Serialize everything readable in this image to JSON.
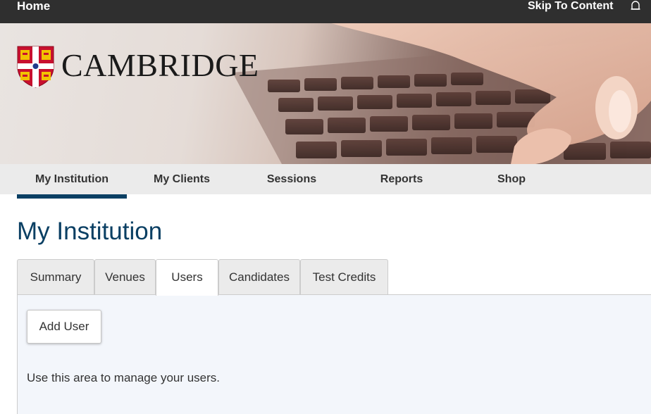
{
  "topbar": {
    "home_label": "Home",
    "skip_label": "Skip To Content",
    "bell_icon": "bell-icon"
  },
  "header": {
    "logo_icon": "cambridge-shield-logo",
    "logo_text": "CAMBRIDGE"
  },
  "main_nav": {
    "items": [
      {
        "label": "My Institution",
        "active": true
      },
      {
        "label": "My Clients"
      },
      {
        "label": "Sessions"
      },
      {
        "label": "Reports"
      },
      {
        "label": "Shop"
      }
    ]
  },
  "page": {
    "title": "My Institution"
  },
  "tabs": [
    {
      "label": "Summary"
    },
    {
      "label": "Venues"
    },
    {
      "label": "Users",
      "active": true
    },
    {
      "label": "Candidates"
    },
    {
      "label": "Test Credits"
    }
  ],
  "panel": {
    "add_user_label": "Add User",
    "description": "Use this area to manage your users."
  },
  "colors": {
    "topbar": "#2f2f2f",
    "nav_background": "#ebebeb",
    "accent": "#0a3f63",
    "panel_background": "#f3f6fb",
    "shield_red": "#c8102e",
    "shield_gold": "#f2c200"
  }
}
